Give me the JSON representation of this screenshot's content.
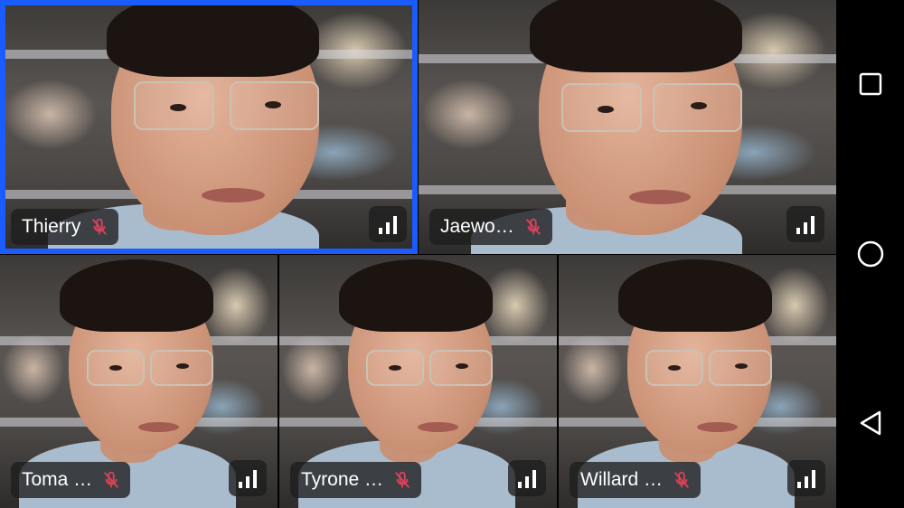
{
  "participants": [
    {
      "name": "Thierry",
      "muted": true,
      "active": true
    },
    {
      "name": "Jaewo…",
      "muted": true,
      "active": false
    },
    {
      "name": "Toma …",
      "muted": true,
      "active": false
    },
    {
      "name": "Tyrone …",
      "muted": true,
      "active": false
    },
    {
      "name": "Willard …",
      "muted": true,
      "active": false
    }
  ],
  "colors": {
    "active_border": "#1a5cff",
    "muted_icon": "#e0405a",
    "label_bg": "#1e1e1e"
  },
  "icons": {
    "muted": "mic-off-icon",
    "signal": "signal-strength-icon"
  },
  "navbar": {
    "buttons": [
      "recents-square-icon",
      "home-circle-icon",
      "back-triangle-icon"
    ]
  }
}
